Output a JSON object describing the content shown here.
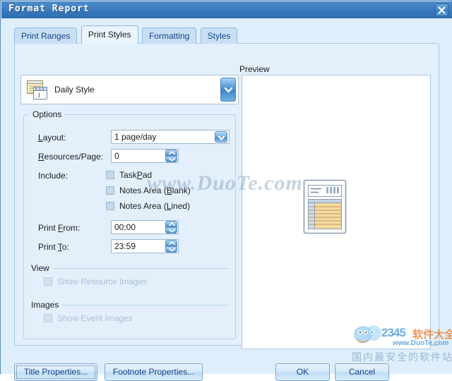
{
  "window": {
    "title": "Format Report",
    "close_icon": "close-icon"
  },
  "tabs": [
    {
      "label": "Print Ranges",
      "active": false
    },
    {
      "label": "Print Styles",
      "active": true
    },
    {
      "label": "Formatting",
      "active": false
    },
    {
      "label": "Styles",
      "active": false
    }
  ],
  "style_combo": {
    "value": "Daily Style",
    "icon": "daily-style-icon",
    "arrow_icon": "chevron-down-icon"
  },
  "options": {
    "group_title": "Options",
    "layout": {
      "label_pre": "",
      "label_accel": "L",
      "label_post": "ayout:",
      "value": "1 page/day",
      "arrow_icon": "chevron-down-icon"
    },
    "resources_per_page": {
      "label_pre": "",
      "label_accel": "R",
      "label_post": "esources/Page:",
      "value": "0",
      "spinner_icon": "spinner-updown-icon"
    },
    "include": {
      "label": "Include:",
      "items": [
        {
          "pre": "Task",
          "accel": "P",
          "post": "ad",
          "checked": false,
          "disabled": false
        },
        {
          "pre": "Notes Area (",
          "accel": "B",
          "post": "lank)",
          "checked": false,
          "disabled": false
        },
        {
          "pre": "Notes Area (",
          "accel": "L",
          "post": "ined)",
          "checked": false,
          "disabled": false
        }
      ]
    },
    "print_from": {
      "label_pre": "Print ",
      "label_accel": "F",
      "label_post": "rom:",
      "value": "00:00",
      "spinner_icon": "spinner-updown-icon"
    },
    "print_to": {
      "label_pre": "Print ",
      "label_accel": "T",
      "label_post": "o:",
      "value": "23:59",
      "spinner_icon": "spinner-updown-icon"
    },
    "view_section": {
      "title": "View",
      "checkbox": {
        "label": "Show Resource Images",
        "checked": false,
        "disabled": true
      }
    },
    "images_section": {
      "title": "Images",
      "checkbox": {
        "label": "Show Event Images",
        "checked": false,
        "disabled": true
      }
    }
  },
  "preview": {
    "label": "Preview",
    "icon": "page-preview-icon"
  },
  "footer": {
    "title_properties": "Title Properties...",
    "footnote_properties": "Footnote Properties...",
    "ok": "OK",
    "cancel": "Cancel"
  },
  "watermarks": {
    "text": "www.DuoTe.com",
    "logo_2345": "2345",
    "logo_cn": "软件大全",
    "logo_url": "www.DuoTe.com",
    "logo_slogan": "国内最安全的软件站"
  },
  "colors": {
    "titlebar": "#3f7fc1",
    "dialog_bg": "#dfeefb",
    "page_bg": "#e3f0fb",
    "tab_active_bg": "#eaf4fd",
    "tab_inactive_bg": "#c9e0f4",
    "accent_text": "#15428b",
    "border": "#a6c9e8"
  }
}
